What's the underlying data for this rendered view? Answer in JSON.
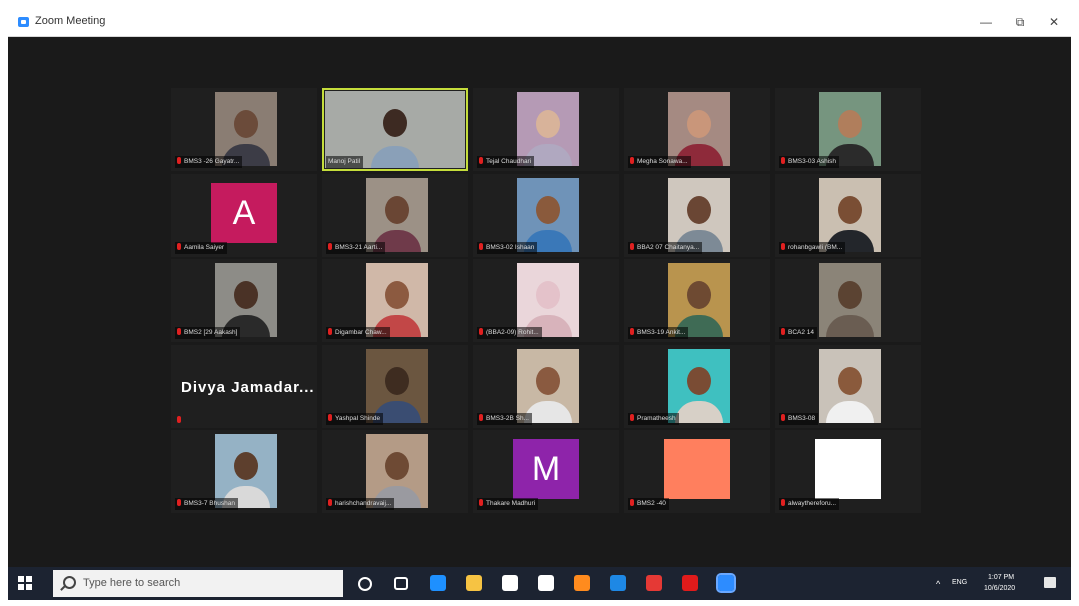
{
  "window": {
    "title": "Zoom Meeting",
    "minimize": "—",
    "maximize": "⧉",
    "close": "✕"
  },
  "participants": [
    {
      "name": "BMS3 -26 Gayatr...",
      "kind": "video",
      "bg": "#8a7d73",
      "face": "#6b4b3a",
      "shirt": "#3c3c46"
    },
    {
      "name": "Manoj Patil",
      "kind": "video-wide",
      "active": true,
      "bg": "#a7aaa6",
      "face": "#3d2a22",
      "shirt": "#8aa0b8",
      "mic": false
    },
    {
      "name": "Tejal Chaudhari",
      "kind": "video",
      "bg": "#b59ab5",
      "face": "#d8b39a",
      "shirt": "#b0a8c0"
    },
    {
      "name": "Megha Sonawa...",
      "kind": "video",
      "bg": "#a58a82",
      "face": "#c9967a",
      "shirt": "#8e2a3a"
    },
    {
      "name": "BMS3-03 Ashish",
      "kind": "video",
      "bg": "#76957f",
      "face": "#b07e5c",
      "shirt": "#2b2b2b"
    },
    {
      "name": "Aamila Saiyer",
      "kind": "avatar",
      "letter": "A",
      "color": "#c51b5e"
    },
    {
      "name": "BMS3-21 Aarti...",
      "kind": "video",
      "bg": "#9c9186",
      "face": "#6a4634",
      "shirt": "#6f3a4a"
    },
    {
      "name": "BMS3-02 Ishaan",
      "kind": "video",
      "bg": "#6f93b8",
      "face": "#8a5a3c",
      "shirt": "#3a78b8"
    },
    {
      "name": "BBA2 07 Chaitanya...",
      "kind": "video",
      "bg": "#cfc7be",
      "face": "#6a4634",
      "shirt": "#7d8a96"
    },
    {
      "name": "rohanbgawli (BM...",
      "kind": "video",
      "bg": "#cabfb1",
      "face": "#7a4e34",
      "shirt": "#23262b"
    },
    {
      "name": "BMS2 [29 Aakash]",
      "kind": "video",
      "bg": "#8d8c87",
      "face": "#4a3226",
      "shirt": "#2a2a2a"
    },
    {
      "name": "Digambar Chaw...",
      "kind": "video",
      "bg": "#d0b8a8",
      "face": "#8c5a40",
      "shirt": "#c24747"
    },
    {
      "name": "(BBA2-09) Rohit...",
      "kind": "video",
      "bg": "#ead6da",
      "face": "#e4c2ca",
      "shirt": "#d8b3bb"
    },
    {
      "name": "BMS3-19 Ankit...",
      "kind": "video",
      "bg": "#b9944e",
      "face": "#6e4a32",
      "shirt": "#3f6b55"
    },
    {
      "name": "BCA2 14",
      "kind": "video",
      "bg": "#8b8478",
      "face": "#5b4332",
      "shirt": "#6a5d52"
    },
    {
      "name": "Divya Jamadar...",
      "kind": "text",
      "mic": true
    },
    {
      "name": "Yashpal Shinde",
      "kind": "video",
      "bg": "#6b5640",
      "face": "#3e2c20",
      "shirt": "#3a4d72"
    },
    {
      "name": "BMS3-2B Sh...",
      "kind": "video",
      "bg": "#c8b8a5",
      "face": "#8a5a40",
      "shirt": "#e6e6e6"
    },
    {
      "name": "Pramatheesh",
      "kind": "video",
      "bg": "#3fc0c0",
      "face": "#7a4c34",
      "shirt": "#d7d0c7"
    },
    {
      "name": "BMS3-08",
      "kind": "video",
      "bg": "#c9c2b9",
      "face": "#8a5a3c",
      "shirt": "#f0f0f0"
    },
    {
      "name": "BMS3-7 Bhushan",
      "kind": "video",
      "bg": "#95b2c5",
      "face": "#5d3f2d",
      "shirt": "#d9d9d9"
    },
    {
      "name": "harishchandravaij...",
      "kind": "video",
      "bg": "#b49b86",
      "face": "#6e4a34",
      "shirt": "#9a9aa0"
    },
    {
      "name": "Thakare Madhuri",
      "kind": "avatar",
      "letter": "M",
      "color": "#8e24aa"
    },
    {
      "name": "BMS2 -40",
      "kind": "avatar",
      "letter": "",
      "color": "#ff7f5e"
    },
    {
      "name": "alwaythereforu...",
      "kind": "avatar",
      "letter": "",
      "color": "#ffffff"
    }
  ],
  "taskbar": {
    "search_placeholder": "Type here to search",
    "time": "1:07 PM",
    "date": "10/6/2020",
    "lang": "ENG",
    "apps": [
      {
        "name": "cortana-icon",
        "color": "#ffffff"
      },
      {
        "name": "task-view-icon",
        "color": "#ffffff"
      },
      {
        "name": "edge-icon",
        "color": "#1e90ff"
      },
      {
        "name": "file-explorer-icon",
        "color": "#f6c343"
      },
      {
        "name": "store-icon",
        "color": "#ffffff"
      },
      {
        "name": "mail-icon",
        "color": "#ffffff"
      },
      {
        "name": "firefox-icon",
        "color": "#ff8b1e"
      },
      {
        "name": "photos-icon",
        "color": "#1e88e5"
      },
      {
        "name": "chrome-icon",
        "color": "#e53935"
      },
      {
        "name": "opera-icon",
        "color": "#e01b1b"
      },
      {
        "name": "zoom-icon",
        "color": "#2d8cff"
      }
    ]
  }
}
